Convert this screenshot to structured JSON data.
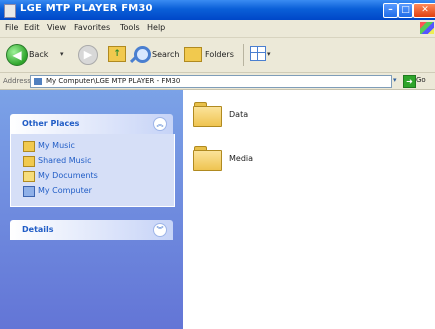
{
  "window": {
    "title": "LGE MTP PLAYER FM30"
  },
  "menu": [
    "File",
    "Edit",
    "View",
    "Favorites",
    "Tools",
    "Help"
  ],
  "toolbar": {
    "back": "Back",
    "search": "Search",
    "folders": "Folders"
  },
  "address": {
    "label": "Address",
    "path": "My Computer\\LGE MTP PLAYER - FM30",
    "go": "Go"
  },
  "other_places": {
    "title": "Other Places",
    "items": [
      {
        "label": "My Music",
        "icon": "music-folder-icon"
      },
      {
        "label": "Shared Music",
        "icon": "shared-music-folder-icon"
      },
      {
        "label": "My Documents",
        "icon": "documents-folder-icon"
      },
      {
        "label": "My Computer",
        "icon": "computer-icon"
      }
    ]
  },
  "details": {
    "title": "Details"
  },
  "folders": [
    {
      "name": "Data"
    },
    {
      "name": "Media"
    }
  ],
  "colors": {
    "titlebar": "#0a5fd8",
    "taskpane": "#7ba2e7",
    "link": "#215dc6"
  }
}
